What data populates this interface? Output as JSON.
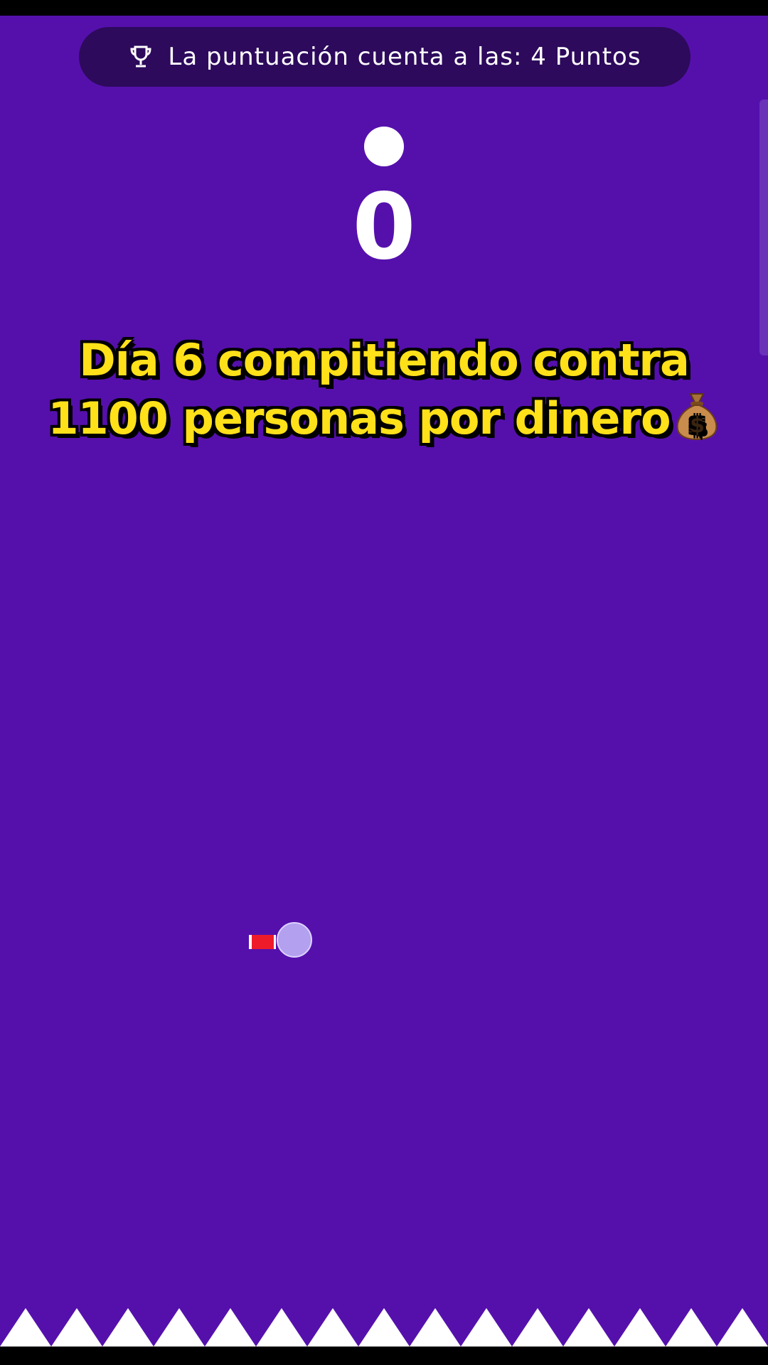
{
  "score_banner": {
    "text": "La puntuación cuenta a las: 4 Puntos",
    "icon": "trophy-icon"
  },
  "score": {
    "value": "0"
  },
  "caption": {
    "line1": "Día 6 compitiendo contra",
    "line2": "1100 personas por dinero",
    "emoji": "money-bag-icon"
  },
  "colors": {
    "background": "#5510ac",
    "banner": "#2d0a5c",
    "caption_text": "#ffe11a",
    "player_ball": "#b3a0ef",
    "player_tail": "#ee1c2a",
    "spikes": "#ffffff"
  }
}
